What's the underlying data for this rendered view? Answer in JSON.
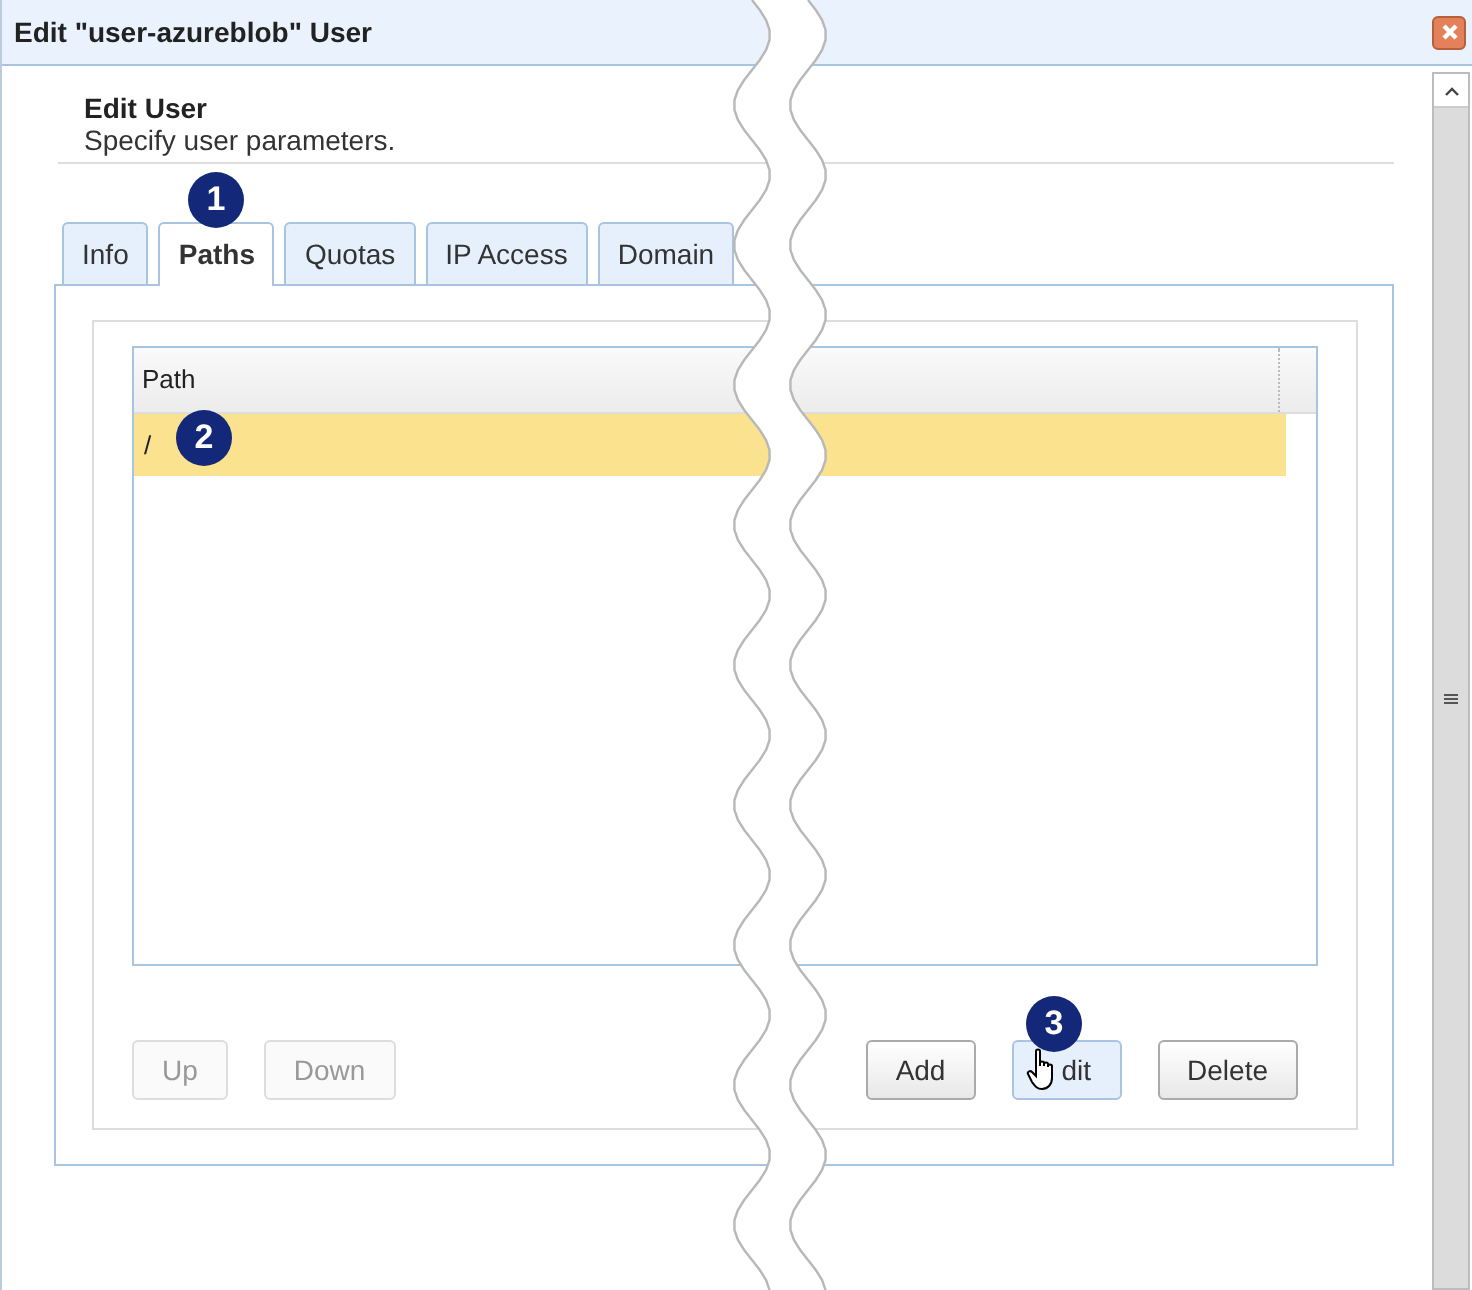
{
  "window": {
    "title": "Edit \"user-azureblob\" User"
  },
  "header": {
    "title": "Edit User",
    "subtitle": "Specify user parameters."
  },
  "tabs": [
    {
      "label": "Info",
      "selected": false
    },
    {
      "label": "Paths",
      "selected": true,
      "step": "1"
    },
    {
      "label": "Quotas",
      "selected": false
    },
    {
      "label": "IP Access",
      "selected": false
    },
    {
      "label": "Domain",
      "selected": false
    }
  ],
  "table": {
    "columns": [
      "Path"
    ],
    "rows": [
      {
        "path": "/",
        "selected": true,
        "step": "2"
      }
    ]
  },
  "left_buttons": [
    {
      "label": "Up",
      "disabled": true,
      "hovered": false
    },
    {
      "label": "Down",
      "disabled": true,
      "hovered": false
    }
  ],
  "right_buttons": [
    {
      "label": "Add",
      "disabled": false,
      "hovered": false
    },
    {
      "label": "dit",
      "disabled": false,
      "hovered": true,
      "step": "3"
    },
    {
      "label": "Delete",
      "disabled": false,
      "hovered": false
    }
  ]
}
